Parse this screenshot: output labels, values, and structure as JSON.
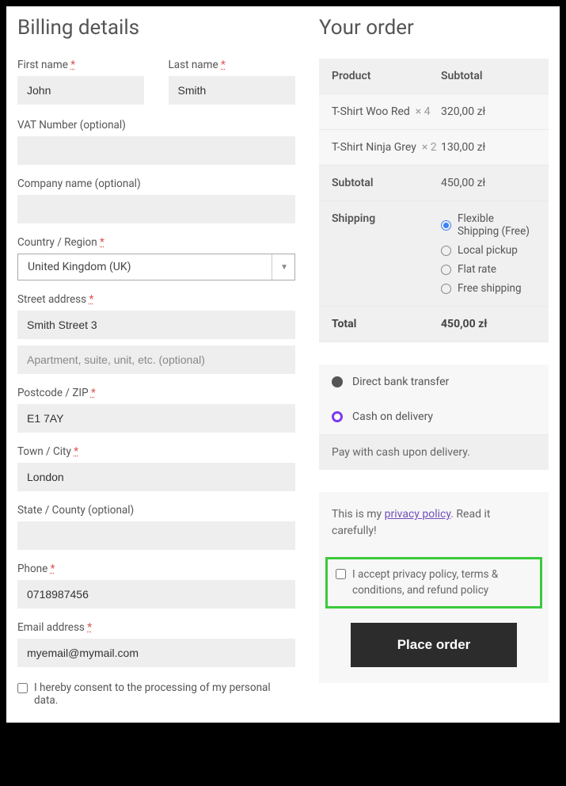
{
  "billing": {
    "heading": "Billing details",
    "first_name": {
      "label": "First name",
      "value": "John"
    },
    "last_name": {
      "label": "Last name",
      "value": "Smith"
    },
    "vat": {
      "label": "VAT Number (optional)",
      "value": ""
    },
    "company": {
      "label": "Company name (optional)",
      "value": ""
    },
    "country": {
      "label": "Country / Region",
      "value": "United Kingdom (UK)"
    },
    "street": {
      "label": "Street address",
      "value": "Smith Street 3",
      "placeholder2": "Apartment, suite, unit, etc. (optional)"
    },
    "postcode": {
      "label": "Postcode / ZIP",
      "value": "E1 7AY"
    },
    "town": {
      "label": "Town / City",
      "value": "London"
    },
    "state": {
      "label": "State / County (optional)",
      "value": ""
    },
    "phone": {
      "label": "Phone",
      "value": "0718987456"
    },
    "email": {
      "label": "Email address",
      "value": "myemail@mymail.com"
    },
    "consent": "I hereby consent to the processing of my personal data."
  },
  "order": {
    "heading": "Your order",
    "th_product": "Product",
    "th_subtotal": "Subtotal",
    "items": [
      {
        "name": "T-Shirt Woo Red",
        "qty": "× 4",
        "subtotal": "320,00 zł"
      },
      {
        "name": "T-Shirt Ninja Grey",
        "qty": "× 2",
        "subtotal": "130,00 zł"
      }
    ],
    "subtotal_label": "Subtotal",
    "subtotal_value": "450,00 zł",
    "shipping_label": "Shipping",
    "shipping_options": [
      {
        "label": "Flexible Shipping (Free)",
        "selected": true
      },
      {
        "label": "Local pickup",
        "selected": false
      },
      {
        "label": "Flat rate",
        "selected": false
      },
      {
        "label": "Free shipping",
        "selected": false
      }
    ],
    "total_label": "Total",
    "total_value": "450,00 zł"
  },
  "payment": {
    "bank": "Direct bank transfer",
    "cod": "Cash on delivery",
    "desc": "Pay with cash upon delivery."
  },
  "privacy": {
    "pre": "This is my ",
    "link": "privacy policy",
    "post": ". Read it carefully!",
    "accept": "I accept privacy policy, terms & conditions, and refund policy",
    "place_order": "Place order"
  }
}
